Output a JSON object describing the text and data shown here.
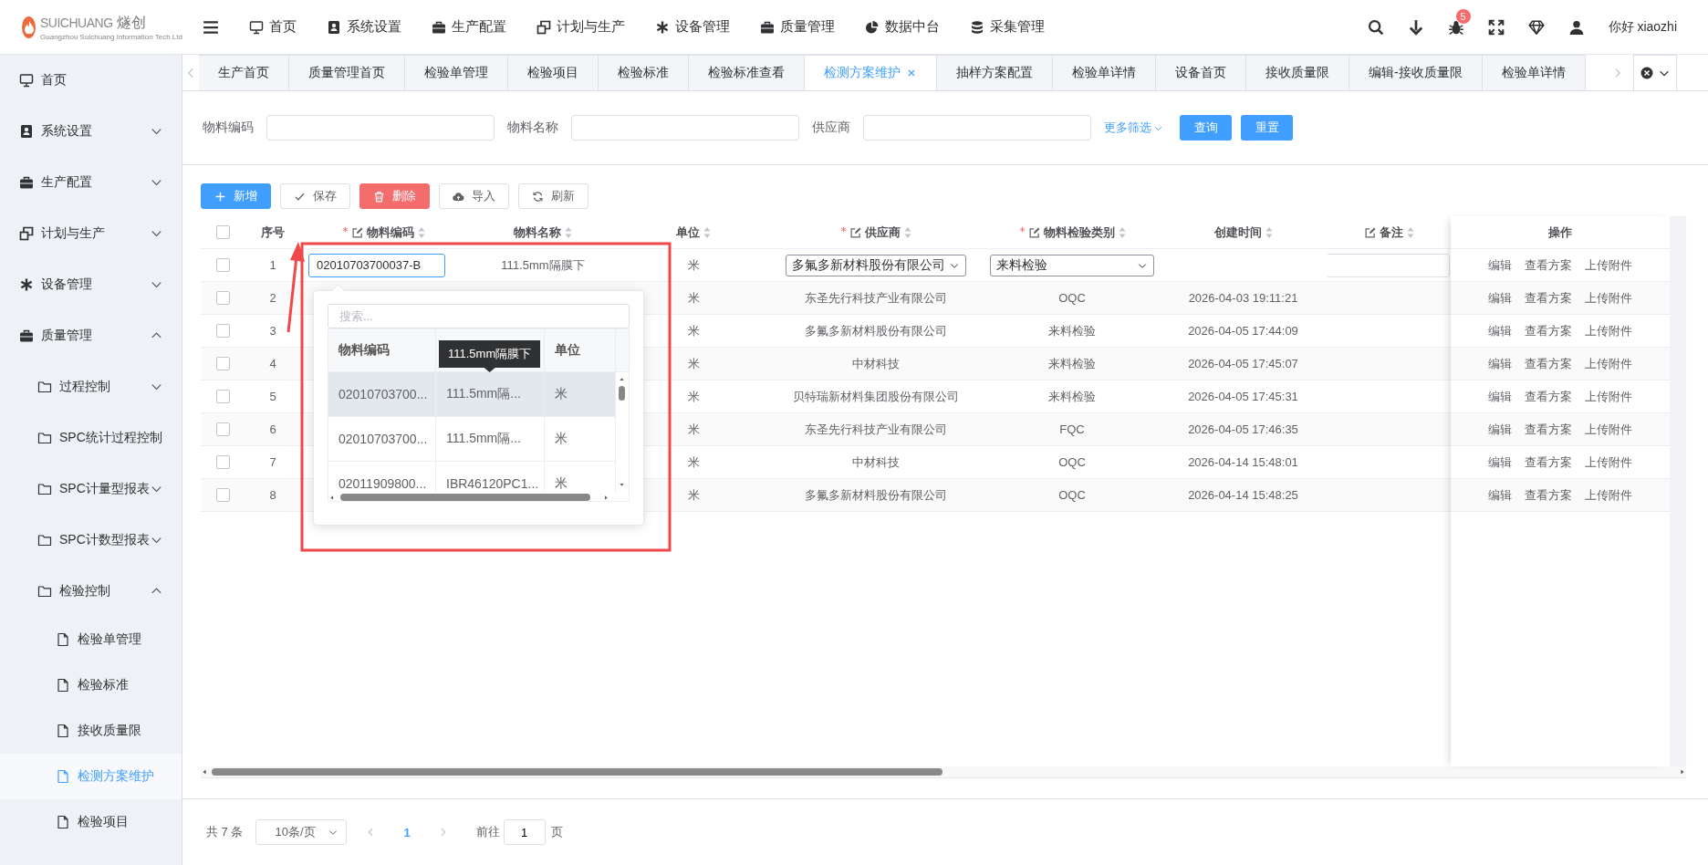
{
  "header": {
    "logo": {
      "brand": "SUICHUANG",
      "brand_cn": "燧创",
      "tagline": "Guangzhou Suichuang Information Tech Ltd"
    },
    "menu": [
      "首页",
      "系统设置",
      "生产配置",
      "计划与生产",
      "设备管理",
      "质量管理",
      "数据中台",
      "采集管理"
    ],
    "badge": "5",
    "greeting": "你好 xiaozhi"
  },
  "sidebar": {
    "items": [
      {
        "label": "首页",
        "selected": false
      },
      {
        "label": "系统设置",
        "selected": false,
        "expanded": false
      },
      {
        "label": "生产配置",
        "selected": false,
        "expanded": false
      },
      {
        "label": "计划与生产",
        "selected": false,
        "expanded": false
      },
      {
        "label": "设备管理",
        "selected": false,
        "expanded": false
      },
      {
        "label": "质量管理",
        "selected": false,
        "expanded": true,
        "children": [
          {
            "label": "过程控制",
            "selected": false,
            "expanded": false
          },
          {
            "label": "SPC统计过程控制",
            "selected": false
          },
          {
            "label": "SPC计量型报表",
            "selected": false,
            "expanded": false
          },
          {
            "label": "SPC计数型报表",
            "selected": false,
            "expanded": false
          },
          {
            "label": "检验控制",
            "selected": false,
            "expanded": true,
            "children": [
              {
                "label": "检验单管理",
                "selected": false
              },
              {
                "label": "检验标准",
                "selected": false
              },
              {
                "label": "接收质量限",
                "selected": false
              },
              {
                "label": "检测方案维护",
                "selected": true
              },
              {
                "label": "检验项目",
                "selected": false
              }
            ]
          }
        ]
      }
    ]
  },
  "tabs": [
    {
      "label": "生产首页",
      "selected": false
    },
    {
      "label": "质量管理首页",
      "selected": false
    },
    {
      "label": "检验单管理",
      "selected": false
    },
    {
      "label": "检验项目",
      "selected": false
    },
    {
      "label": "检验标准",
      "selected": false
    },
    {
      "label": "检验标准查看",
      "selected": false
    },
    {
      "label": "检测方案维护",
      "selected": true
    },
    {
      "label": "抽样方案配置",
      "selected": false
    },
    {
      "label": "检验单详情",
      "selected": false
    },
    {
      "label": "设备首页",
      "selected": false
    },
    {
      "label": "接收质量限",
      "selected": false
    },
    {
      "label": "编辑-接收质量限",
      "selected": false
    },
    {
      "label": "检验单详情",
      "selected": false
    }
  ],
  "filters": {
    "fields": [
      {
        "label": "物料编码"
      },
      {
        "label": "物料名称"
      },
      {
        "label": "供应商"
      }
    ],
    "more": "更多筛选",
    "buttons": [
      "查询",
      "重置"
    ]
  },
  "toolbar": [
    {
      "label": "新增",
      "kind": "primary"
    },
    {
      "label": "保存",
      "kind": "plain"
    },
    {
      "label": "删除",
      "kind": "danger"
    },
    {
      "label": "导入",
      "kind": "plain"
    },
    {
      "label": "刷新",
      "kind": "plain"
    }
  ],
  "table": {
    "all_checked": false,
    "columns": [
      {
        "label": "序号",
        "required": false,
        "editable": false,
        "sortable": false
      },
      {
        "label": "物料编码",
        "required": true,
        "editable": true,
        "sortable": true
      },
      {
        "label": "物料名称",
        "required": false,
        "editable": false,
        "sortable": true
      },
      {
        "label": "单位",
        "required": false,
        "editable": false,
        "sortable": true
      },
      {
        "label": "供应商",
        "required": true,
        "editable": true,
        "sortable": true
      },
      {
        "label": "物料检验类别",
        "required": true,
        "editable": true,
        "sortable": true
      },
      {
        "label": "创建时间",
        "required": false,
        "editable": false,
        "sortable": true
      },
      {
        "label": "备注",
        "required": false,
        "editable": true,
        "sortable": true
      },
      {
        "label": "操作",
        "required": false,
        "editable": false,
        "sortable": false
      }
    ],
    "rows": [
      {
        "kind": "edit",
        "checked": false,
        "index": "1",
        "material_code": "02010703700037-B",
        "material_name": "111.5mm隔膜下",
        "unit": "米",
        "supplier": "多氟多新材料股份有限公司",
        "category": "来料检验",
        "actions": [
          "编辑",
          "查看方案",
          "上传附件"
        ]
      },
      {
        "kind": "view",
        "checked": false,
        "index": "2",
        "unit": "米",
        "supplier": "东圣先行科技产业有限公司",
        "category": "OQC",
        "created": "2026-04-03 19:11:21",
        "actions": [
          "编辑",
          "查看方案",
          "上传附件"
        ]
      },
      {
        "kind": "view",
        "checked": false,
        "index": "3",
        "unit": "米",
        "supplier": "多氟多新材料股份有限公司",
        "category": "来料检验",
        "created": "2026-04-05 17:44:09",
        "actions": [
          "编辑",
          "查看方案",
          "上传附件"
        ]
      },
      {
        "kind": "view",
        "checked": false,
        "index": "4",
        "unit": "米",
        "supplier": "中材科技",
        "category": "来料检验",
        "created": "2026-04-05 17:45:07",
        "actions": [
          "编辑",
          "查看方案",
          "上传附件"
        ]
      },
      {
        "kind": "view",
        "checked": false,
        "index": "5",
        "unit": "米",
        "supplier": "贝特瑞新材料集团股份有限公司",
        "category": "来料检验",
        "created": "2026-04-05 17:45:31",
        "actions": [
          "编辑",
          "查看方案",
          "上传附件"
        ]
      },
      {
        "kind": "view",
        "checked": false,
        "index": "6",
        "unit": "米",
        "supplier": "东圣先行科技产业有限公司",
        "category": "FQC",
        "created": "2026-04-05 17:46:35",
        "actions": [
          "编辑",
          "查看方案",
          "上传附件"
        ]
      },
      {
        "kind": "view",
        "checked": false,
        "index": "7",
        "unit": "米",
        "supplier": "中材科技",
        "category": "OQC",
        "created": "2026-04-14 15:48:01",
        "actions": [
          "编辑",
          "查看方案",
          "上传附件"
        ]
      },
      {
        "kind": "view",
        "checked": false,
        "index": "8",
        "unit": "米",
        "supplier": "多氟多新材料股份有限公司",
        "category": "OQC",
        "created": "2026-04-14 15:48:25",
        "actions": [
          "编辑",
          "查看方案",
          "上传附件"
        ]
      }
    ]
  },
  "picker": {
    "search_placeholder": "搜索...",
    "headers": {
      "code": "物料编码",
      "unit": "单位"
    },
    "rows": [
      {
        "code": "02010703700...",
        "name": "111.5mm隔...",
        "unit": "米",
        "hovered": true
      },
      {
        "code": "02010703700...",
        "name": "111.5mm隔...",
        "unit": "米",
        "hovered": false
      },
      {
        "code": "02011909800...",
        "name": "IBR46120PC1...",
        "unit": "米",
        "hovered": false
      }
    ],
    "tooltip": "111.5mm隔膜下"
  },
  "pagination": {
    "total": "共 7 条",
    "page_size": "10条/页",
    "pages": [
      {
        "label": "1",
        "selected": true
      }
    ],
    "goto_label": "前往",
    "goto_value": "1",
    "page_suffix": "页"
  }
}
